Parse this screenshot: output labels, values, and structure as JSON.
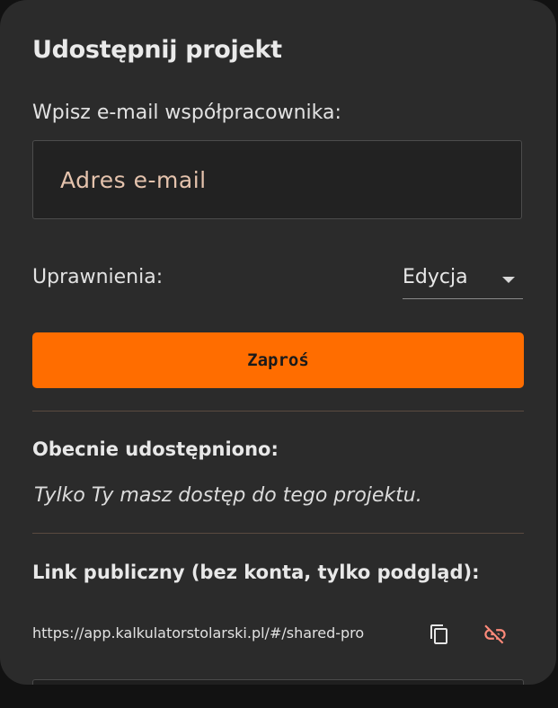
{
  "dialog": {
    "title": "Udostępnij projekt"
  },
  "invite": {
    "email_label": "Wpisz e-mail współpracownika:",
    "email_placeholder": "Adres e-mail",
    "email_value": "",
    "permissions_label": "Uprawnienia:",
    "permissions_selected": "Edycja",
    "button_label": "Zaproś"
  },
  "shared": {
    "heading": "Obecnie udostępniono:",
    "empty_message": "Tylko Ty masz dostęp do tego projektu."
  },
  "public_link": {
    "heading": "Link publiczny (bez konta, tylko podgląd):",
    "url": "https://app.kalkulatorstolarski.pl/#/shared-pro",
    "copy_icon": "copy-icon",
    "unlink_icon": "link-off-icon"
  },
  "colors": {
    "accent": "#ff6d00",
    "unlink_icon": "#ff8a7a",
    "dialog_bg": "#2b2b2b",
    "placeholder": "#e5c3ad"
  }
}
